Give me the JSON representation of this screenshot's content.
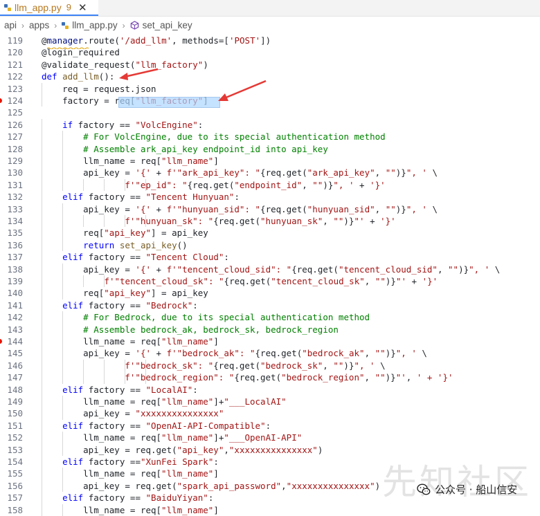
{
  "tab": {
    "filename": "llm_app.py",
    "problem_count": "9",
    "close_glyph": "✕",
    "icon_color": "#3b6fb6"
  },
  "breadcrumb": {
    "items": [
      "api",
      "apps",
      "llm_app.py",
      "set_api_key"
    ],
    "separator": "›"
  },
  "watermark": {
    "label": "公众号 · 船山信安",
    "background_text": "先知社区"
  },
  "colors": {
    "keyword": "#0000ff",
    "string": "#a31515",
    "comment": "#008000",
    "variable": "#001080",
    "function": "#795e26",
    "selection": "#add6ff",
    "breakpoint": "#e51400",
    "tab_accent": "#3b82f6",
    "arrow": "#e53935"
  },
  "lines": [
    {
      "n": "119",
      "bp": false,
      "ind": 0,
      "toks": [
        [
          "p",
          "@"
        ],
        [
          "v",
          "manager"
        ],
        [
          "p",
          ".route("
        ],
        [
          "s",
          "'/add_llm'"
        ],
        [
          "p",
          ", methods=["
        ],
        [
          "s",
          "'POST'"
        ],
        [
          "p",
          "])"
        ]
      ]
    },
    {
      "n": "120",
      "bp": false,
      "ind": 0,
      "toks": [
        [
          "p",
          "@login_required"
        ]
      ]
    },
    {
      "n": "121",
      "bp": false,
      "ind": 0,
      "toks": [
        [
          "p",
          "@validate_request("
        ],
        [
          "s",
          "\"llm_factory\""
        ],
        [
          "p",
          ")"
        ]
      ]
    },
    {
      "n": "122",
      "bp": false,
      "ind": 0,
      "toks": [
        [
          "k",
          "def "
        ],
        [
          "f",
          "add_llm"
        ],
        [
          "p",
          "():"
        ]
      ]
    },
    {
      "n": "123",
      "bp": false,
      "ind": 1,
      "toks": [
        [
          "p",
          "req = request.json"
        ]
      ]
    },
    {
      "n": "124",
      "bp": true,
      "ind": 1,
      "toks": [
        [
          "p",
          "factory = req["
        ],
        [
          "s",
          "\"llm_factory\""
        ],
        [
          "p",
          "]"
        ]
      ]
    },
    {
      "n": "125",
      "bp": false,
      "ind": 0,
      "toks": [
        [
          "p",
          ""
        ]
      ]
    },
    {
      "n": "126",
      "bp": false,
      "ind": 1,
      "toks": [
        [
          "k",
          "if "
        ],
        [
          "p",
          "factory == "
        ],
        [
          "s",
          "\"VolcEngine\""
        ],
        [
          "p",
          ":"
        ]
      ]
    },
    {
      "n": "127",
      "bp": false,
      "ind": 2,
      "toks": [
        [
          "c",
          "# For VolcEngine, due to its special authentication method"
        ]
      ]
    },
    {
      "n": "128",
      "bp": false,
      "ind": 2,
      "toks": [
        [
          "c",
          "# Assemble ark_api_key endpoint_id into api_key"
        ]
      ]
    },
    {
      "n": "129",
      "bp": false,
      "ind": 2,
      "toks": [
        [
          "p",
          "llm_name = req["
        ],
        [
          "s",
          "\"llm_name\""
        ],
        [
          "p",
          "]"
        ]
      ]
    },
    {
      "n": "130",
      "bp": false,
      "ind": 2,
      "toks": [
        [
          "p",
          "api_key = "
        ],
        [
          "s",
          "'{'"
        ],
        [
          "p",
          " + "
        ],
        [
          "s",
          "f'\"ark_api_key\": \""
        ],
        [
          "p",
          "{req.get("
        ],
        [
          "s",
          "\"ark_api_key\""
        ],
        [
          "p",
          ", "
        ],
        [
          "s",
          "\"\""
        ],
        [
          "p",
          ")}"
        ],
        [
          "s",
          "\", '"
        ],
        [
          "p",
          " \\"
        ]
      ]
    },
    {
      "n": "131",
      "bp": false,
      "ind": 6,
      "toks": [
        [
          "s",
          "f'\"ep_id\": \""
        ],
        [
          "p",
          "{req.get("
        ],
        [
          "s",
          "\"endpoint_id\""
        ],
        [
          "p",
          ", "
        ],
        [
          "s",
          "\"\""
        ],
        [
          "p",
          ")}"
        ],
        [
          "s",
          "\", '"
        ],
        [
          "p",
          " + "
        ],
        [
          "s",
          "'}'"
        ]
      ]
    },
    {
      "n": "132",
      "bp": false,
      "ind": 1,
      "toks": [
        [
          "k",
          "elif "
        ],
        [
          "p",
          "factory == "
        ],
        [
          "s",
          "\"Tencent Hunyuan\""
        ],
        [
          "p",
          ":"
        ]
      ]
    },
    {
      "n": "133",
      "bp": false,
      "ind": 2,
      "toks": [
        [
          "p",
          "api_key = "
        ],
        [
          "s",
          "'{'"
        ],
        [
          "p",
          " + "
        ],
        [
          "s",
          "f'\"hunyuan_sid\": \""
        ],
        [
          "p",
          "{req.get("
        ],
        [
          "s",
          "\"hunyuan_sid\""
        ],
        [
          "p",
          ", "
        ],
        [
          "s",
          "\"\""
        ],
        [
          "p",
          ")}"
        ],
        [
          "s",
          "\", '"
        ],
        [
          "p",
          " \\"
        ]
      ]
    },
    {
      "n": "134",
      "bp": false,
      "ind": 6,
      "toks": [
        [
          "s",
          "f'\"hunyuan_sk\": \""
        ],
        [
          "p",
          "{req.get("
        ],
        [
          "s",
          "\"hunyuan_sk\""
        ],
        [
          "p",
          ", "
        ],
        [
          "s",
          "\"\""
        ],
        [
          "p",
          ")}"
        ],
        [
          "s",
          "\"'"
        ],
        [
          "p",
          " + "
        ],
        [
          "s",
          "'}'"
        ]
      ]
    },
    {
      "n": "135",
      "bp": false,
      "ind": 2,
      "toks": [
        [
          "p",
          "req["
        ],
        [
          "s",
          "\"api_key\""
        ],
        [
          "p",
          "] = api_key"
        ]
      ]
    },
    {
      "n": "136",
      "bp": false,
      "ind": 2,
      "toks": [
        [
          "k",
          "return "
        ],
        [
          "f",
          "set_api_key"
        ],
        [
          "p",
          "()"
        ]
      ]
    },
    {
      "n": "137",
      "bp": false,
      "ind": 1,
      "toks": [
        [
          "k",
          "elif "
        ],
        [
          "p",
          "factory == "
        ],
        [
          "s",
          "\"Tencent Cloud\""
        ],
        [
          "p",
          ":"
        ]
      ]
    },
    {
      "n": "138",
      "bp": false,
      "ind": 2,
      "toks": [
        [
          "p",
          "api_key = "
        ],
        [
          "s",
          "'{'"
        ],
        [
          "p",
          " + "
        ],
        [
          "s",
          "f'\"tencent_cloud_sid\": \""
        ],
        [
          "p",
          "{req.get("
        ],
        [
          "s",
          "\"tencent_cloud_sid\""
        ],
        [
          "p",
          ", "
        ],
        [
          "s",
          "\"\""
        ],
        [
          "p",
          ")}"
        ],
        [
          "s",
          "\", '"
        ],
        [
          "p",
          " \\"
        ]
      ]
    },
    {
      "n": "139",
      "bp": false,
      "ind": 4,
      "toks": [
        [
          "s",
          "f'\"tencent_cloud_sk\": \""
        ],
        [
          "p",
          "{req.get("
        ],
        [
          "s",
          "\"tencent_cloud_sk\""
        ],
        [
          "p",
          ", "
        ],
        [
          "s",
          "\"\""
        ],
        [
          "p",
          ")}"
        ],
        [
          "s",
          "\"'"
        ],
        [
          "p",
          " + "
        ],
        [
          "s",
          "'}'"
        ]
      ]
    },
    {
      "n": "140",
      "bp": false,
      "ind": 2,
      "toks": [
        [
          "p",
          "req["
        ],
        [
          "s",
          "\"api_key\""
        ],
        [
          "p",
          "] = api_key"
        ]
      ]
    },
    {
      "n": "141",
      "bp": false,
      "ind": 1,
      "toks": [
        [
          "k",
          "elif "
        ],
        [
          "p",
          "factory == "
        ],
        [
          "s",
          "\"Bedrock\""
        ],
        [
          "p",
          ":"
        ]
      ]
    },
    {
      "n": "142",
      "bp": false,
      "ind": 2,
      "toks": [
        [
          "c",
          "# For Bedrock, due to its special authentication method"
        ]
      ]
    },
    {
      "n": "143",
      "bp": false,
      "ind": 2,
      "toks": [
        [
          "c",
          "# Assemble bedrock_ak, bedrock_sk, bedrock_region"
        ]
      ]
    },
    {
      "n": "144",
      "bp": true,
      "ind": 2,
      "toks": [
        [
          "p",
          "llm_name = req["
        ],
        [
          "s",
          "\"llm_name\""
        ],
        [
          "p",
          "]"
        ]
      ]
    },
    {
      "n": "145",
      "bp": false,
      "ind": 2,
      "toks": [
        [
          "p",
          "api_key = "
        ],
        [
          "s",
          "'{'"
        ],
        [
          "p",
          " + "
        ],
        [
          "s",
          "f'\"bedrock_ak\": \""
        ],
        [
          "p",
          "{req.get("
        ],
        [
          "s",
          "\"bedrock_ak\""
        ],
        [
          "p",
          ", "
        ],
        [
          "s",
          "\"\""
        ],
        [
          "p",
          ")}"
        ],
        [
          "s",
          "\", '"
        ],
        [
          "p",
          " \\"
        ]
      ]
    },
    {
      "n": "146",
      "bp": false,
      "ind": 6,
      "toks": [
        [
          "s",
          "f'\"bedrock_sk\": \""
        ],
        [
          "p",
          "{req.get("
        ],
        [
          "s",
          "\"bedrock_sk\""
        ],
        [
          "p",
          ", "
        ],
        [
          "s",
          "\"\""
        ],
        [
          "p",
          ")}"
        ],
        [
          "s",
          "\", '"
        ],
        [
          "p",
          " \\"
        ]
      ]
    },
    {
      "n": "147",
      "bp": false,
      "ind": 6,
      "toks": [
        [
          "s",
          "f'\"bedrock_region\": \""
        ],
        [
          "p",
          "{req.get("
        ],
        [
          "s",
          "\"bedrock_region\""
        ],
        [
          "p",
          ", "
        ],
        [
          "s",
          "\"\""
        ],
        [
          "p",
          ")}"
        ],
        [
          "s",
          "\"'"
        ],
        [
          "p",
          ", "
        ],
        [
          "s",
          "' + '"
        ],
        [
          "s",
          "}'"
        ]
      ]
    },
    {
      "n": "148",
      "bp": false,
      "ind": 1,
      "toks": [
        [
          "k",
          "elif "
        ],
        [
          "p",
          "factory == "
        ],
        [
          "s",
          "\"LocalAI\""
        ],
        [
          "p",
          ":"
        ]
      ]
    },
    {
      "n": "149",
      "bp": false,
      "ind": 2,
      "toks": [
        [
          "p",
          "llm_name = req["
        ],
        [
          "s",
          "\"llm_name\""
        ],
        [
          "p",
          "]+"
        ],
        [
          "s",
          "\"___LocalAI\""
        ]
      ]
    },
    {
      "n": "150",
      "bp": false,
      "ind": 2,
      "toks": [
        [
          "p",
          "api_key = "
        ],
        [
          "s",
          "\"xxxxxxxxxxxxxxx\""
        ]
      ]
    },
    {
      "n": "151",
      "bp": false,
      "ind": 1,
      "toks": [
        [
          "k",
          "elif "
        ],
        [
          "p",
          "factory == "
        ],
        [
          "s",
          "\"OpenAI-API-Compatible\""
        ],
        [
          "p",
          ":"
        ]
      ]
    },
    {
      "n": "152",
      "bp": false,
      "ind": 2,
      "toks": [
        [
          "p",
          "llm_name = req["
        ],
        [
          "s",
          "\"llm_name\""
        ],
        [
          "p",
          "]+"
        ],
        [
          "s",
          "\"___OpenAI-API\""
        ]
      ]
    },
    {
      "n": "153",
      "bp": false,
      "ind": 2,
      "toks": [
        [
          "p",
          "api_key = req.get("
        ],
        [
          "s",
          "\"api_key\""
        ],
        [
          "p",
          ","
        ],
        [
          "s",
          "\"xxxxxxxxxxxxxxx\""
        ],
        [
          "p",
          ")"
        ]
      ]
    },
    {
      "n": "154",
      "bp": false,
      "ind": 1,
      "toks": [
        [
          "k",
          "elif "
        ],
        [
          "p",
          "factory =="
        ],
        [
          "s",
          "\"XunFei Spark\""
        ],
        [
          "p",
          ":"
        ]
      ]
    },
    {
      "n": "155",
      "bp": false,
      "ind": 2,
      "toks": [
        [
          "p",
          "llm_name = req["
        ],
        [
          "s",
          "\"llm_name\""
        ],
        [
          "p",
          "]"
        ]
      ]
    },
    {
      "n": "156",
      "bp": false,
      "ind": 2,
      "toks": [
        [
          "p",
          "api_key = req.get("
        ],
        [
          "s",
          "\"spark_api_password\""
        ],
        [
          "p",
          ","
        ],
        [
          "s",
          "\"xxxxxxxxxxxxxxx\""
        ],
        [
          "p",
          ")"
        ]
      ]
    },
    {
      "n": "157",
      "bp": false,
      "ind": 1,
      "toks": [
        [
          "k",
          "elif "
        ],
        [
          "p",
          "factory == "
        ],
        [
          "s",
          "\"BaiduYiyan\""
        ],
        [
          "p",
          ":"
        ]
      ]
    },
    {
      "n": "158",
      "bp": false,
      "ind": 2,
      "toks": [
        [
          "p",
          "llm_name = req["
        ],
        [
          "s",
          "\"llm_name\""
        ],
        [
          "p",
          "]"
        ]
      ]
    }
  ]
}
